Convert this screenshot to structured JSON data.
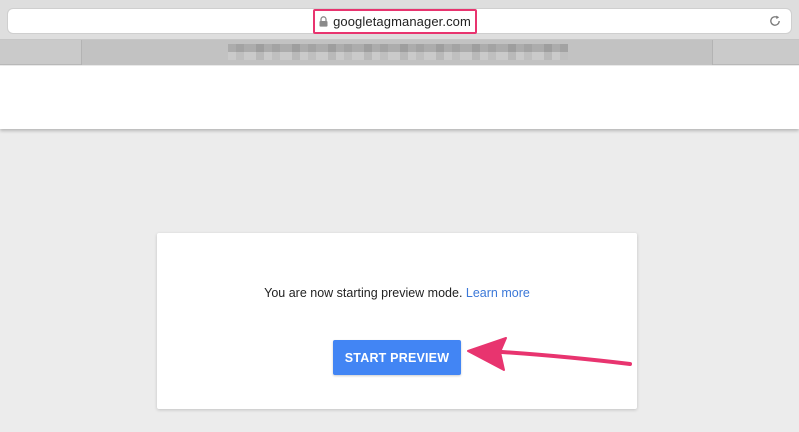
{
  "browser": {
    "url": "googletagmanager.com"
  },
  "dialog": {
    "message": "You are now starting preview mode.",
    "learn_more_label": "Learn more",
    "start_button_label": "START PREVIEW"
  },
  "colors": {
    "highlight": "#e8346f",
    "button": "#4285f4",
    "link": "#3b78d8"
  },
  "icons": {
    "address": "lock-icon",
    "reload": "reload-icon",
    "annotation": "arrow-annotation"
  }
}
